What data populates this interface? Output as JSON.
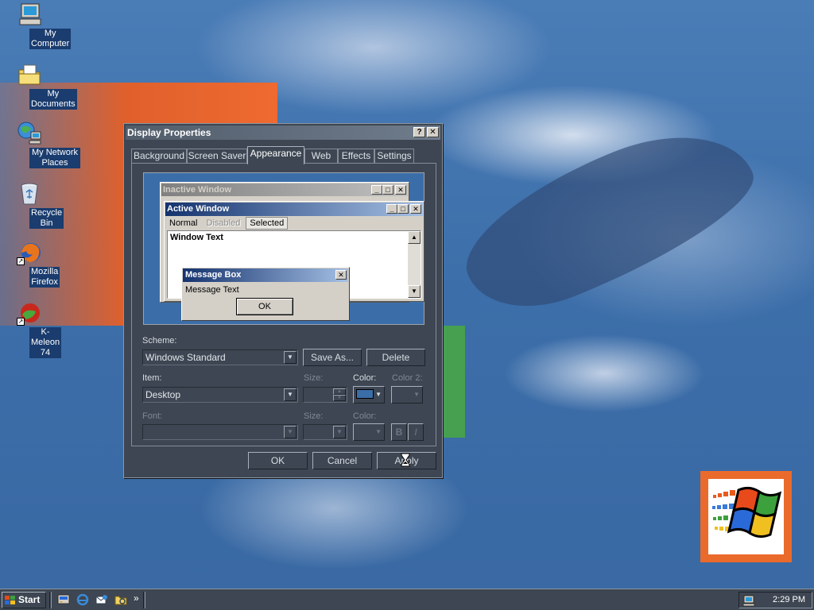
{
  "desktop": {
    "icons": [
      {
        "label": "My Computer"
      },
      {
        "label": "My Documents"
      },
      {
        "label": "My Network Places"
      },
      {
        "label": "Recycle Bin"
      },
      {
        "label": "Mozilla Firefox"
      },
      {
        "label": "K-Meleon 74"
      }
    ]
  },
  "dialog": {
    "title": "Display Properties",
    "title_buttons": {
      "help": "?",
      "close": "✕"
    },
    "tabs": [
      "Background",
      "Screen Saver",
      "Appearance",
      "Web",
      "Effects",
      "Settings"
    ],
    "active_tab": "Appearance",
    "preview": {
      "inactive_title": "Inactive Window",
      "active_title": "Active Window",
      "menu": {
        "normal": "Normal",
        "disabled": "Disabled",
        "selected": "Selected"
      },
      "window_text": "Window Text",
      "message_box_title": "Message Box",
      "message_text": "Message Text",
      "ok_label": "OK"
    },
    "scheme": {
      "label": "Scheme:",
      "value": "Windows Standard",
      "save_as": "Save As...",
      "delete": "Delete"
    },
    "item": {
      "label": "Item:",
      "value": "Desktop",
      "size_label": "Size:",
      "color_label": "Color:",
      "color2_label": "Color 2:",
      "color_value": "#3b6ea8"
    },
    "font": {
      "label": "Font:",
      "size_label": "Size:",
      "color_label": "Color:",
      "bold": "B",
      "italic": "I"
    },
    "buttons": {
      "ok": "OK",
      "cancel": "Cancel",
      "apply": "Apply"
    }
  },
  "taskbar": {
    "start_label": "Start",
    "quick_launch_more": "»",
    "clock": "2:29 PM"
  },
  "colors": {
    "desktop": "#3b6ea8",
    "window_face": "#3d4652",
    "active_title": "#14326e",
    "logo_frame": "#ea6a2c"
  }
}
